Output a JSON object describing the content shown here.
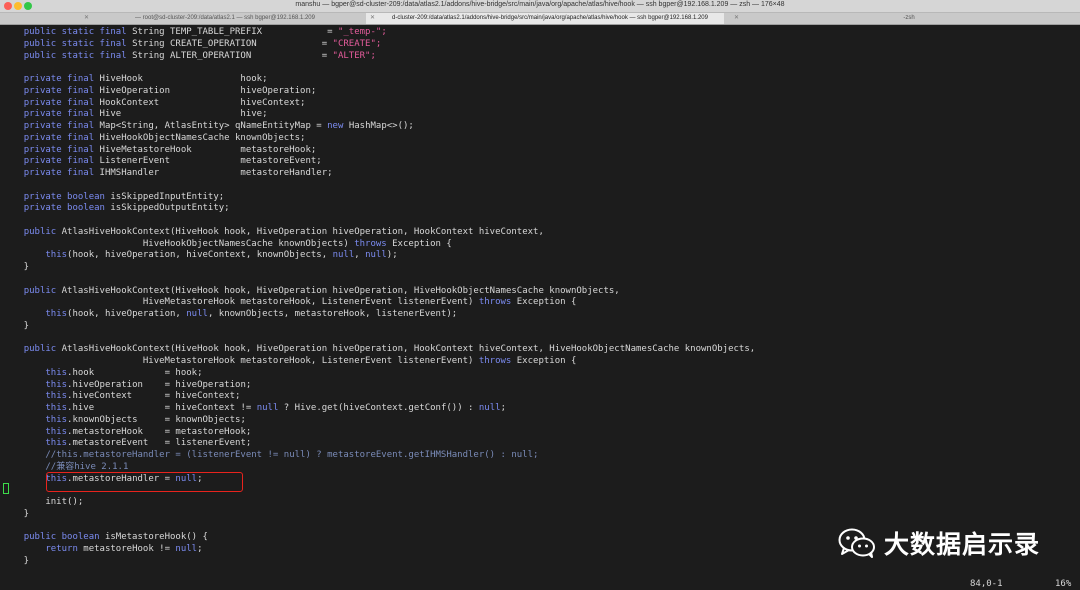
{
  "window": {
    "title": "manshu — bgper@sd-cluster-209:/data/atlas2.1/addons/hive-bridge/src/main/java/org/apache/atlas/hive/hook — ssh bgper@192.168.1.209 — zsh — 176×48",
    "tabs": [
      {
        "label": "— root@sd-cluster-209:/data/atlas2.1 — ssh bgper@192.168.1.209",
        "active": false
      },
      {
        "label": "d-cluster-209:/data/atlas2.1/addons/hive-bridge/src/main/java/org/apache/atlas/hive/hook — ssh bgper@192.168.1.209",
        "active": true
      },
      {
        "label": "-zsh",
        "active": false
      }
    ]
  },
  "code_lines": [
    [
      [
        "",
        "    "
      ],
      [
        "k",
        "public static final "
      ],
      [
        "",
        "String TEMP_TABLE_PREFIX            = "
      ],
      [
        "s",
        "\"_temp-\";"
      ]
    ],
    [
      [
        "",
        "    "
      ],
      [
        "k",
        "public static final "
      ],
      [
        "",
        "String CREATE_OPERATION            = "
      ],
      [
        "s",
        "\"CREATE\";"
      ]
    ],
    [
      [
        "",
        "    "
      ],
      [
        "k",
        "public static final "
      ],
      [
        "",
        "String ALTER_OPERATION             = "
      ],
      [
        "s",
        "\"ALTER\";"
      ]
    ],
    [],
    [
      [
        "",
        "    "
      ],
      [
        "k",
        "private final "
      ],
      [
        "",
        "HiveHook                  hook;"
      ]
    ],
    [
      [
        "",
        "    "
      ],
      [
        "k",
        "private final "
      ],
      [
        "",
        "HiveOperation             hiveOperation;"
      ]
    ],
    [
      [
        "",
        "    "
      ],
      [
        "k",
        "private final "
      ],
      [
        "",
        "HookContext               hiveContext;"
      ]
    ],
    [
      [
        "",
        "    "
      ],
      [
        "k",
        "private final "
      ],
      [
        "",
        "Hive                      hive;"
      ]
    ],
    [
      [
        "",
        "    "
      ],
      [
        "k",
        "private final "
      ],
      [
        "",
        "Map<String, AtlasEntity> qNameEntityMap = "
      ],
      [
        "k",
        "new "
      ],
      [
        "",
        "HashMap<>();"
      ]
    ],
    [
      [
        "",
        "    "
      ],
      [
        "k",
        "private final "
      ],
      [
        "",
        "HiveHookObjectNamesCache knownObjects;"
      ]
    ],
    [
      [
        "",
        "    "
      ],
      [
        "k",
        "private final "
      ],
      [
        "",
        "HiveMetastoreHook         metastoreHook;"
      ]
    ],
    [
      [
        "",
        "    "
      ],
      [
        "k",
        "private final "
      ],
      [
        "",
        "ListenerEvent             metastoreEvent;"
      ]
    ],
    [
      [
        "",
        "    "
      ],
      [
        "k",
        "private final "
      ],
      [
        "",
        "IHMSHandler               metastoreHandler;"
      ]
    ],
    [],
    [
      [
        "",
        "    "
      ],
      [
        "k",
        "private boolean "
      ],
      [
        "",
        "isSkippedInputEntity;"
      ]
    ],
    [
      [
        "",
        "    "
      ],
      [
        "k",
        "private boolean "
      ],
      [
        "",
        "isSkippedOutputEntity;"
      ]
    ],
    [],
    [
      [
        "",
        "    "
      ],
      [
        "k",
        "public "
      ],
      [
        "",
        "AtlasHiveHookContext(HiveHook hook, HiveOperation hiveOperation, HookContext hiveContext,"
      ]
    ],
    [
      [
        "",
        "                          HiveHookObjectNamesCache knownObjects) "
      ],
      [
        "k",
        "throws "
      ],
      [
        "",
        "Exception {"
      ]
    ],
    [
      [
        "",
        "        "
      ],
      [
        "k",
        "this"
      ],
      [
        "",
        "(hook, hiveOperation, hiveContext, knownObjects, "
      ],
      [
        "k",
        "null"
      ],
      [
        "",
        ", "
      ],
      [
        "k",
        "null"
      ],
      [
        "",
        ");"
      ]
    ],
    [
      [
        "",
        "    }"
      ]
    ],
    [],
    [
      [
        "",
        "    "
      ],
      [
        "k",
        "public "
      ],
      [
        "",
        "AtlasHiveHookContext(HiveHook hook, HiveOperation hiveOperation, HiveHookObjectNamesCache knownObjects,"
      ]
    ],
    [
      [
        "",
        "                          HiveMetastoreHook metastoreHook, ListenerEvent listenerEvent) "
      ],
      [
        "k",
        "throws "
      ],
      [
        "",
        "Exception {"
      ]
    ],
    [
      [
        "",
        "        "
      ],
      [
        "k",
        "this"
      ],
      [
        "",
        "(hook, hiveOperation, "
      ],
      [
        "k",
        "null"
      ],
      [
        "",
        ", knownObjects, metastoreHook, listenerEvent);"
      ]
    ],
    [
      [
        "",
        "    }"
      ]
    ],
    [],
    [
      [
        "",
        "    "
      ],
      [
        "k",
        "public "
      ],
      [
        "",
        "AtlasHiveHookContext(HiveHook hook, HiveOperation hiveOperation, HookContext hiveContext, HiveHookObjectNamesCache knownObjects,"
      ]
    ],
    [
      [
        "",
        "                          HiveMetastoreHook metastoreHook, ListenerEvent listenerEvent) "
      ],
      [
        "k",
        "throws "
      ],
      [
        "",
        "Exception {"
      ]
    ],
    [
      [
        "",
        "        "
      ],
      [
        "k",
        "this"
      ],
      [
        "",
        ".hook             = hook;"
      ]
    ],
    [
      [
        "",
        "        "
      ],
      [
        "k",
        "this"
      ],
      [
        "",
        ".hiveOperation    = hiveOperation;"
      ]
    ],
    [
      [
        "",
        "        "
      ],
      [
        "k",
        "this"
      ],
      [
        "",
        ".hiveContext      = hiveContext;"
      ]
    ],
    [
      [
        "",
        "        "
      ],
      [
        "k",
        "this"
      ],
      [
        "",
        ".hive             = hiveContext != "
      ],
      [
        "k",
        "null"
      ],
      [
        "",
        " ? Hive.get(hiveContext.getConf()) : "
      ],
      [
        "k",
        "null"
      ],
      [
        "",
        ";"
      ]
    ],
    [
      [
        "",
        "        "
      ],
      [
        "k",
        "this"
      ],
      [
        "",
        ".knownObjects     = knownObjects;"
      ]
    ],
    [
      [
        "",
        "        "
      ],
      [
        "k",
        "this"
      ],
      [
        "",
        ".metastoreHook    = metastoreHook;"
      ]
    ],
    [
      [
        "",
        "        "
      ],
      [
        "k",
        "this"
      ],
      [
        "",
        ".metastoreEvent   = listenerEvent;"
      ]
    ],
    [
      [
        "",
        "        "
      ],
      [
        "c",
        "//this.metastoreHandler = (listenerEvent != null) ? metastoreEvent.getIHMSHandler() : null;"
      ]
    ],
    [
      [
        "",
        "        "
      ],
      [
        "c",
        "//兼容hive 2.1.1"
      ]
    ],
    [
      [
        "",
        "        "
      ],
      [
        "k",
        "this"
      ],
      [
        "",
        ".metastoreHandler = "
      ],
      [
        "k",
        "null"
      ],
      [
        "",
        ";"
      ]
    ],
    [],
    [
      [
        "",
        "        init();"
      ]
    ],
    [
      [
        "",
        "    }"
      ]
    ],
    [],
    [
      [
        "",
        "    "
      ],
      [
        "k",
        "public boolean "
      ],
      [
        "",
        "isMetastoreHook() {"
      ]
    ],
    [
      [
        "",
        "        "
      ],
      [
        "k",
        "return "
      ],
      [
        "",
        "metastoreHook != "
      ],
      [
        "k",
        "null"
      ],
      [
        "",
        ";"
      ]
    ],
    [
      [
        "",
        "    }"
      ]
    ]
  ],
  "status": {
    "position": "84,0-1",
    "percent": "16%"
  },
  "watermark": {
    "text": "大数据启示录",
    "icon": "wechat-icon"
  }
}
